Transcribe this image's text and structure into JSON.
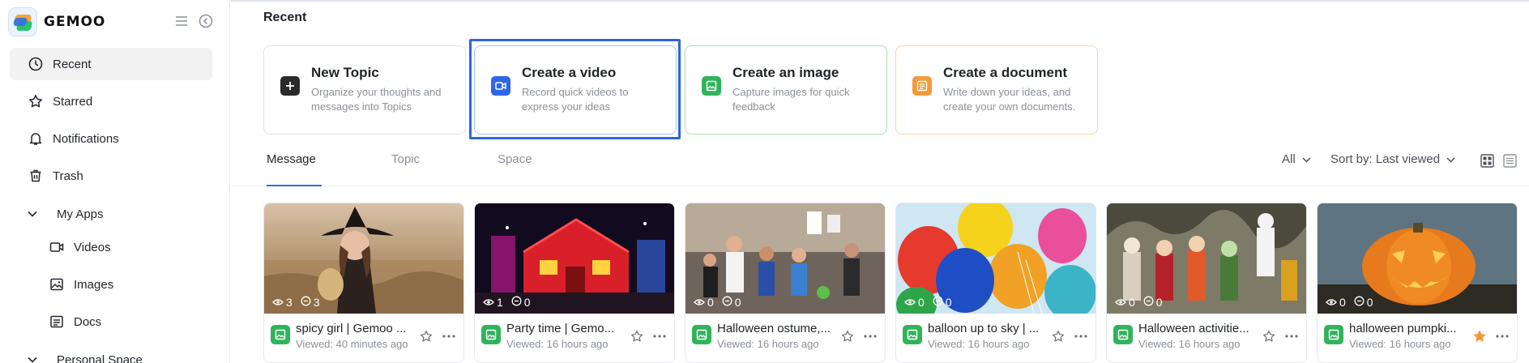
{
  "brand": {
    "name": "GEMOO",
    "logo_icon": "gemoo-logo"
  },
  "sidebar": {
    "items": [
      {
        "label": "Recent",
        "icon": "clock-icon",
        "active": true
      },
      {
        "label": "Starred",
        "icon": "star-icon"
      },
      {
        "label": "Notifications",
        "icon": "bell-icon"
      },
      {
        "label": "Trash",
        "icon": "trash-icon"
      }
    ],
    "my_apps": {
      "label": "My Apps",
      "items": [
        {
          "label": "Videos",
          "icon": "video-icon"
        },
        {
          "label": "Images",
          "icon": "image-icon"
        },
        {
          "label": "Docs",
          "icon": "doc-icon"
        }
      ]
    },
    "personal_space": {
      "label": "Personal Space"
    }
  },
  "main": {
    "title": "Recent",
    "create_cards": [
      {
        "title": "New Topic",
        "desc": "Organize your thoughts and messages into Topics",
        "color": "#2b2b2b",
        "border": "#e0e2e6"
      },
      {
        "title": "Create a video",
        "desc": "Record quick videos to express your ideas",
        "color": "#2f66e8",
        "border": "#a9c3f3"
      },
      {
        "title": "Create an image",
        "desc": "Capture images for quick feedback",
        "color": "#31b35b",
        "border": "#a9dfb8"
      },
      {
        "title": "Create a document",
        "desc": "Write down your ideas, and create your own documents.",
        "color": "#f39a3a",
        "border": "#f6d7b1"
      }
    ],
    "tabs": [
      {
        "label": "Message",
        "active": true
      },
      {
        "label": "Topic"
      },
      {
        "label": "Space"
      }
    ],
    "filter": {
      "all_label": "All",
      "sort_label": "Sort by: Last viewed"
    },
    "cards": [
      {
        "title": "spicy girl | Gemoo ...",
        "viewed": "Viewed: 40 minutes ago",
        "views": "3",
        "comments": "3",
        "starred": false
      },
      {
        "title": "Party time | Gemo...",
        "viewed": "Viewed: 16 hours ago",
        "views": "1",
        "comments": "0",
        "starred": false
      },
      {
        "title": "Halloween ostume,...",
        "viewed": "Viewed: 16 hours ago",
        "views": "0",
        "comments": "0",
        "starred": false
      },
      {
        "title": "balloon up to sky | ...",
        "viewed": "Viewed: 16 hours ago",
        "views": "0",
        "comments": "0",
        "starred": false
      },
      {
        "title": "Halloween activitie...",
        "viewed": "Viewed: 16 hours ago",
        "views": "0",
        "comments": "0",
        "starred": false
      },
      {
        "title": "halloween pumpki...",
        "viewed": "Viewed: 16 hours ago",
        "views": "0",
        "comments": "0",
        "starred": true
      }
    ]
  }
}
